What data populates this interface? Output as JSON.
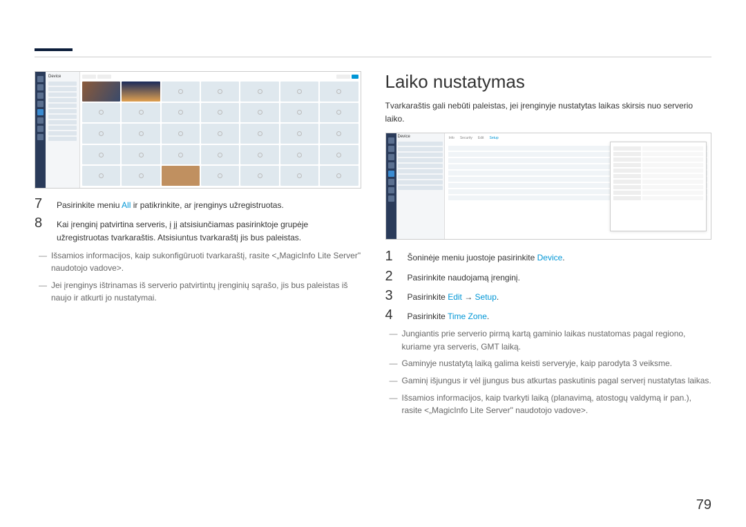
{
  "page_number": "79",
  "left": {
    "step7": {
      "num": "7",
      "prefix": "Pasirinkite meniu ",
      "link": "All",
      "suffix": " ir patikrinkite, ar įrenginys užregistruotas."
    },
    "step8": {
      "num": "8",
      "text": "Kai įrenginį patvirtina serveris, į jį atsisiunčiamas pasirinktoje grupėje užregistruotas tvarkaraštis. Atsisiuntus tvarkaraštį jis bus paleistas."
    },
    "note1": "Išsamios informacijos, kaip sukonfigūruoti tvarkaraštį, rasite <„MagicInfo Lite Server\" naudotojo vadove>.",
    "note2": "Jei įrenginys ištrinamas iš serverio patvirtintų įrenginių sąrašo, jis bus paleistas iš naujo ir atkurti jo nustatymai."
  },
  "right": {
    "heading": "Laiko nustatymas",
    "intro": "Tvarkaraštis gali nebūti paleistas, jei įrenginyje nustatytas laikas skirsis nuo serverio laiko.",
    "step1": {
      "num": "1",
      "prefix": "Šoninėje meniu juostoje pasirinkite ",
      "link": "Device",
      "suffix": "."
    },
    "step2": {
      "num": "2",
      "text": "Pasirinkite naudojamą įrenginį."
    },
    "step3": {
      "num": "3",
      "prefix": "Pasirinkite ",
      "link1": "Edit",
      "arrow": " → ",
      "link2": "Setup",
      "suffix": "."
    },
    "step4": {
      "num": "4",
      "prefix": "Pasirinkite ",
      "link": "Time Zone",
      "suffix": "."
    },
    "note1": "Jungiantis prie serverio pirmą kartą gaminio laikas nustatomas pagal regiono, kuriame yra serveris, GMT laiką.",
    "note2": "Gaminyje nustatytą laiką galima keisti serveryje, kaip parodyta 3 veiksme.",
    "note3": "Gaminį išjungus ir vėl įjungus bus atkurtas paskutinis pagal serverį nustatytas laikas.",
    "note4": "Išsamios informacijos, kaip tvarkyti laiką (planavimą, atostogų valdymą ir pan.), rasite <„MagicInfo Lite Server\" naudotojo vadove>."
  },
  "ss1": {
    "title": "Device",
    "tabs": {
      "info": "Info",
      "security": "Security",
      "edit": "Edit",
      "setup": "Setup"
    }
  }
}
